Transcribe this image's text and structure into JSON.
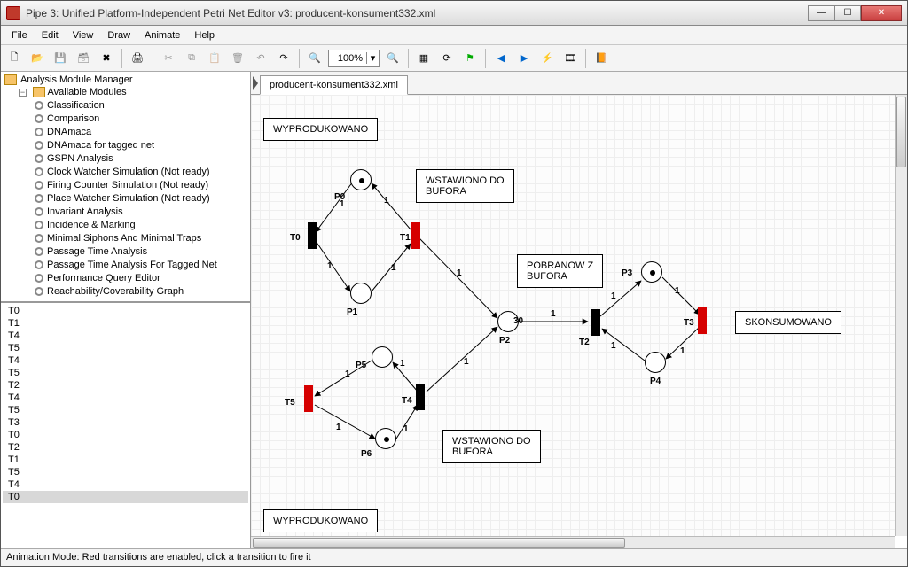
{
  "window": {
    "title": "Pipe 3: Unified Platform-Independent Petri Net Editor v3: producent-konsument332.xml"
  },
  "menubar": {
    "file": "File",
    "edit": "Edit",
    "view": "View",
    "draw": "Draw",
    "animate": "Animate",
    "help": "Help"
  },
  "toolbar": {
    "zoom_value": "100%"
  },
  "tree": {
    "root": "Analysis Module Manager",
    "group": "Available Modules",
    "items": [
      "Classification",
      "Comparison",
      "DNAmaca",
      "DNAmaca for tagged net",
      "GSPN Analysis",
      "Clock Watcher Simulation (Not ready)",
      "Firing Counter Simulation (Not ready)",
      "Place Watcher Simulation (Not ready)",
      "Invariant Analysis",
      "Incidence & Marking",
      "Minimal Siphons And Minimal Traps",
      "Passage Time Analysis",
      "Passage Time Analysis For Tagged Net",
      "Performance Query Editor",
      "Reachability/Coverability Graph"
    ]
  },
  "history": [
    "T0",
    "T1",
    "T4",
    "T5",
    "T4",
    "T5",
    "T2",
    "T4",
    "T5",
    "T3",
    "T0",
    "T2",
    "T1",
    "T5",
    "T4",
    "T0"
  ],
  "history_sel": 15,
  "tab": {
    "label": "producent-konsument332.xml"
  },
  "net": {
    "labels": {
      "wyp1": "WYPRODUKOWANO",
      "wyp2": "WYPRODUKOWANO",
      "wst1": "WSTAWIONO DO\nBUFORA",
      "wst2": "WSTAWIONO DO\nBUFORA",
      "pob": "POBRANOW Z\nBUFORA",
      "skon": "SKONSUMOWANO"
    },
    "plabels": {
      "P0": "P0",
      "P1": "P1",
      "P2": "P2",
      "P3": "P3",
      "P4": "P4",
      "P5": "P5",
      "P6": "P6"
    },
    "tlabels": {
      "T0": "T0",
      "T1": "T1",
      "T2": "T2",
      "T3": "T3",
      "T4": "T4",
      "T5": "T5"
    },
    "arc_w": "1",
    "p2_cap": "30"
  },
  "status": "Animation Mode: Red transitions are enabled, click a transition to fire it"
}
